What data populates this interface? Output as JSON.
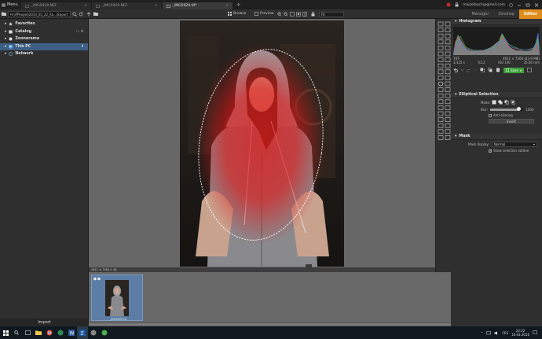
{
  "titlebar": {
    "menu_label": "Menu",
    "tabs": [
      {
        "label": "_IMG5928.NEF",
        "active": false
      },
      {
        "label": "_IMG5929.NEF",
        "active": false
      },
      {
        "label": "_IMG5929.tif*",
        "active": true
      }
    ],
    "tab_close": "×",
    "add_tab": "+",
    "user_email": "majzelbach@gmail.com"
  },
  "toolbar": {
    "path": "H:\\#People\\2014_05_22_Ra...\\Export",
    "browse_label": "Browse",
    "preview_label": "Preview",
    "zoom_select": "Fit",
    "modes": [
      {
        "label": "Manager",
        "active": false
      },
      {
        "label": "Develop",
        "active": false
      },
      {
        "label": "Editor",
        "active": true
      }
    ]
  },
  "navigator": {
    "items": [
      {
        "label": "Favorites",
        "selected": false
      },
      {
        "label": "Catalog",
        "selected": false
      },
      {
        "label": "Zoonerama",
        "selected": false
      },
      {
        "label": "This PC",
        "selected": true
      },
      {
        "label": "Network",
        "selected": false
      }
    ],
    "import_label": "Import"
  },
  "image_info": "4911 × 7360 × 48",
  "filmstrip": {
    "thumbnail_label": "_IMG5929.tif"
  },
  "histogram": {
    "title": "Histogram",
    "meta_left": "TIFF",
    "meta_right": "4911 × 7360 (23.9 MB)",
    "exif": [
      "1/125 s",
      "f/2.2",
      "ISO 100",
      "35.00 mm"
    ]
  },
  "history": {
    "save_label": "Save"
  },
  "elliptical_selection": {
    "title": "Elliptical Selection",
    "mode_label": "Mode:",
    "blur_label": "Blur:",
    "blur_value": "1000",
    "blur_level_percent": 85,
    "antialiasing_label": "Anti-aliasing",
    "antialiasing_checked": false,
    "invert_label": "Invert"
  },
  "mask": {
    "title": "Mask",
    "display_label": "Mask display:",
    "display_value": "Normal",
    "show_outline_label": "Show selection outline",
    "show_outline_checked": true
  },
  "taskbar": {
    "lang": "CES",
    "time": "22:22",
    "date": "16.03.2016"
  },
  "colors": {
    "accent": "#e08c1c",
    "selection_blue": "#3d5f85",
    "save_green": "#3ea13a",
    "mask_red": "#e02020"
  }
}
